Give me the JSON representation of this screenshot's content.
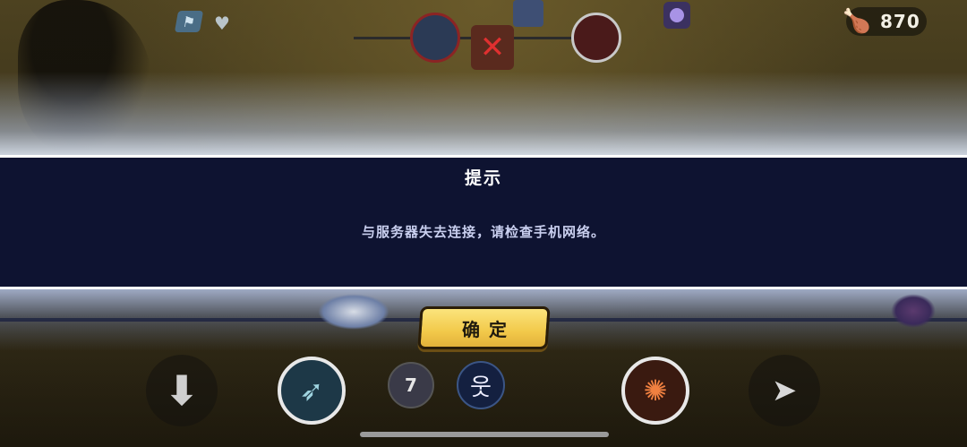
{
  "hud": {
    "currency_icon": "drumstick-icon",
    "currency_amount": "870",
    "left_icons": [
      "flag-icon",
      "heart-plus-icon"
    ],
    "vs_left_portrait": "dragon-portrait-icon",
    "vs_right_portrait": "demon-portrait-icon",
    "defeated_ally_icon": "defeated-portrait-icon",
    "buff_icon": "purple-orb-icon"
  },
  "dialog": {
    "title": "提示",
    "message": "与服务器失去连接，请检查手机网络。",
    "confirm_label": "确定",
    "background_color": "#0e1331",
    "confirm_color": "#f2c94a"
  },
  "skills": [
    {
      "name": "down-arrow-icon",
      "glyph": "🡇"
    },
    {
      "name": "bow-skill-icon",
      "glyph": "➶"
    },
    {
      "name": "cooldown-skill-icon",
      "glyph": "7"
    },
    {
      "name": "stickman-skill-icon",
      "glyph": "웃"
    },
    {
      "name": "fire-skill-icon",
      "glyph": "✺"
    },
    {
      "name": "dash-skill-icon",
      "glyph": "➤"
    }
  ],
  "cooldown_value": "7"
}
